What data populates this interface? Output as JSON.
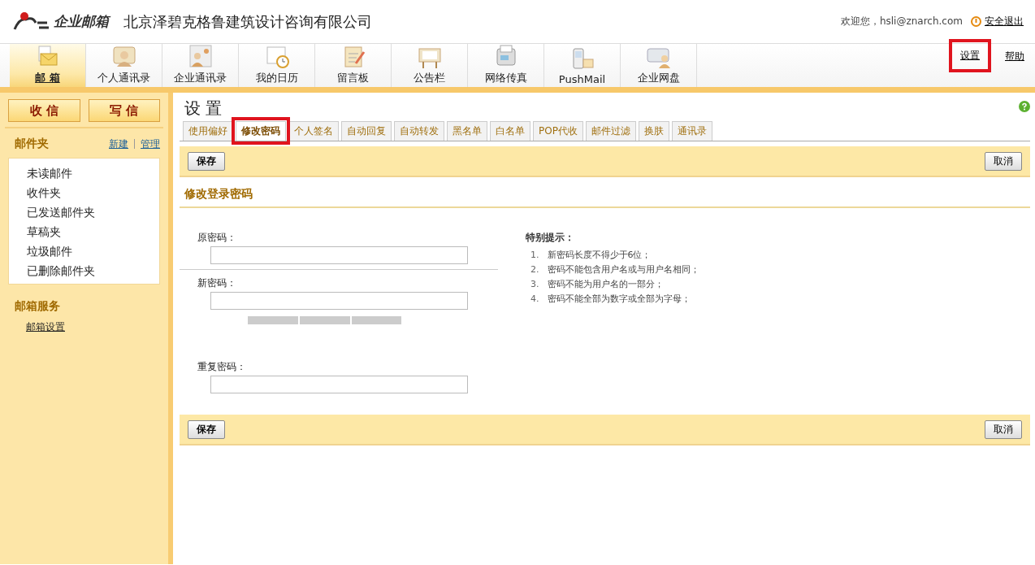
{
  "header": {
    "brand": "企业邮箱",
    "company": "北京泽碧克格鲁建筑设计咨询有限公司",
    "welcome": "欢迎您，hsli@znarch.com",
    "logout": "安全退出"
  },
  "nav": {
    "items": [
      {
        "label": "邮 箱",
        "selected": true
      },
      {
        "label": "个人通讯录",
        "selected": false
      },
      {
        "label": "企业通讯录",
        "selected": false
      },
      {
        "label": "我的日历",
        "selected": false
      },
      {
        "label": "留言板",
        "selected": false
      },
      {
        "label": "公告栏",
        "selected": false
      },
      {
        "label": "网络传真",
        "selected": false
      },
      {
        "label": "PushMail",
        "selected": false
      },
      {
        "label": "企业网盘",
        "selected": false
      }
    ],
    "links": [
      {
        "label": "设置",
        "highlighted": true
      },
      {
        "label": "帮助",
        "highlighted": false
      }
    ]
  },
  "sidebar": {
    "buttons": [
      "收 信",
      "写 信"
    ],
    "folders_title": "邮件夹",
    "folder_actions": [
      "新建",
      "管理"
    ],
    "folders": [
      "未读邮件",
      "收件夹",
      "已发送邮件夹",
      "草稿夹",
      "垃圾邮件",
      "已删除邮件夹"
    ],
    "services_title": "邮箱服务",
    "services": [
      "邮箱设置"
    ]
  },
  "main": {
    "title": "设 置",
    "tabs": [
      {
        "label": "使用偏好",
        "selected": false,
        "highlighted": false
      },
      {
        "label": "修改密码",
        "selected": true,
        "highlighted": true
      },
      {
        "label": "个人签名",
        "selected": false,
        "highlighted": false
      },
      {
        "label": "自动回复",
        "selected": false,
        "highlighted": false
      },
      {
        "label": "自动转发",
        "selected": false,
        "highlighted": false
      },
      {
        "label": "黑名单",
        "selected": false,
        "highlighted": false
      },
      {
        "label": "白名单",
        "selected": false,
        "highlighted": false
      },
      {
        "label": "POP代收",
        "selected": false,
        "highlighted": false
      },
      {
        "label": "邮件过滤",
        "selected": false,
        "highlighted": false
      },
      {
        "label": "换肤",
        "selected": false,
        "highlighted": false
      },
      {
        "label": "通讯录",
        "selected": false,
        "highlighted": false
      }
    ],
    "bars": [
      {
        "save": "保存",
        "cancel": "取消"
      },
      {
        "save": "保存",
        "cancel": "取消"
      }
    ],
    "section_title": "修改登录密码",
    "fields": [
      {
        "label": "原密码："
      },
      {
        "label": "新密码："
      },
      {
        "label": "重复密码："
      }
    ],
    "tips_title": "特别提示：",
    "tips": [
      {
        "num": "1.",
        "text": "新密码长度不得少于6位；"
      },
      {
        "num": "2.",
        "text": "密码不能包含用户名或与用户名相同；"
      },
      {
        "num": "3.",
        "text": "密码不能为用户名的一部分；"
      },
      {
        "num": "4.",
        "text": "密码不能全部为数字或全部为字母；"
      }
    ]
  }
}
